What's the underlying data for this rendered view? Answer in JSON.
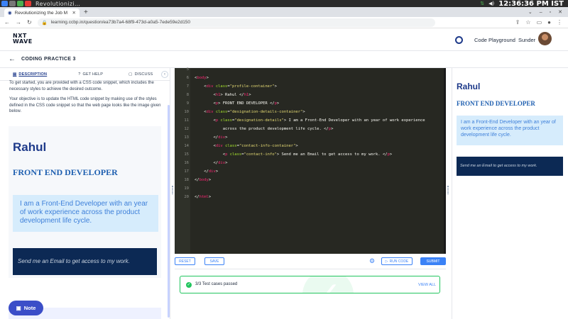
{
  "taskbar": {
    "title": "Revolutionizi…",
    "clock": "12:36:36 PM IST"
  },
  "browser": {
    "tab_title": "Revolutionizing the Job M",
    "url": "learning.ccbp.in/question/ea73b7a4-68f9-473d-a0a5-7ede59e2d150"
  },
  "header": {
    "logo_line1": "NXT",
    "logo_line2": "WAVE",
    "code_playground": "Code Playground",
    "user": "Sunder"
  },
  "subheader": {
    "title": "CODING PRACTICE 3"
  },
  "left_tabs": {
    "description": "DESCRIPTION",
    "get_help": "GET HELP",
    "discuss": "DISCUSS"
  },
  "description": {
    "intro": "To get started, you are provided with a CSS code snippet, which includes the necessary styles to achieve the desired outcome.",
    "objective": "Your objective is to update the HTML code snippet by making use of the styles defined in the CSS code snippet so that the web page looks like the image given below."
  },
  "preview": {
    "name": "Rahul",
    "role": "FRONT END DEVELOPER",
    "desc": "I am a Front-End Developer with an year of work experience across the product development life cycle.",
    "contact": "Send me an Email to get access to my work."
  },
  "note_button": "Note",
  "editor": {
    "lines": [
      {
        "n": "5",
        "code": ""
      },
      {
        "n": "6",
        "code": "<body>"
      },
      {
        "n": "7",
        "code": "    <div class=\"profile-container\">"
      },
      {
        "n": "8",
        "code": "        <h1> Rahul </h1>"
      },
      {
        "n": "9",
        "code": "        <p> FRONT END DEVELOPER </p>"
      },
      {
        "n": "10",
        "code": "    <div class=\"designation-details-container\">"
      },
      {
        "n": "11",
        "code": "        <p class=\"designation-details\"> I am a Front-End Developer with an year of work experience"
      },
      {
        "n": "12",
        "code": "            across the product development life cycle. </p>"
      },
      {
        "n": "13",
        "code": "        </div>"
      },
      {
        "n": "14",
        "code": "        <div class=\"contact-info-container\">"
      },
      {
        "n": "15",
        "code": "            <p class=\"contact-info\"> Send me an Email to get access to my work. </p>"
      },
      {
        "n": "16",
        "code": "        </div>"
      },
      {
        "n": "17",
        "code": "    </div>"
      },
      {
        "n": "18",
        "code": "</body>"
      },
      {
        "n": "19",
        "code": ""
      },
      {
        "n": "20",
        "code": "</html>"
      }
    ]
  },
  "editor_bar": {
    "reset": "RESET",
    "save": "SAVE",
    "run_code": "RUN CODE",
    "submit": "SUBMIT"
  },
  "result": {
    "text": "3/3 Test cases passed",
    "view_all": "VIEW ALL"
  },
  "output": {
    "name": "Rahul",
    "role": "FRONT END DEVELOPER",
    "desc": "I am a Front-End Developer with an year of work experience across the product development life cycle.",
    "contact": "Send me an Email to get access to my work."
  }
}
